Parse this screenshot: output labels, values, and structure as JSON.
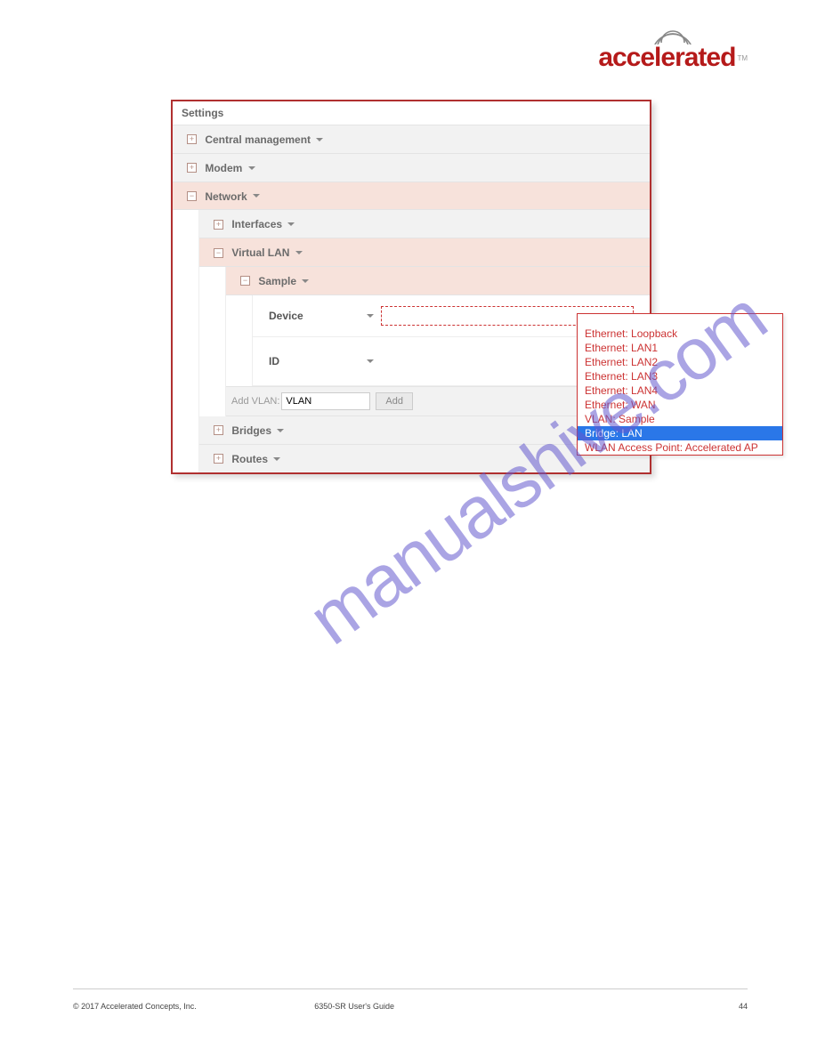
{
  "logo": {
    "text": "accelerated",
    "tm": "TM"
  },
  "panel": {
    "title": "Settings"
  },
  "rows": {
    "central": {
      "label": "Central management",
      "icon": "+"
    },
    "modem": {
      "label": "Modem",
      "icon": "+"
    },
    "network": {
      "label": "Network",
      "icon": "−"
    },
    "interfaces": {
      "label": "Interfaces",
      "icon": "+"
    },
    "vlan": {
      "label": "Virtual LAN",
      "icon": "−"
    },
    "sample": {
      "label": "Sample",
      "icon": "−"
    },
    "bridges": {
      "label": "Bridges",
      "icon": "+"
    },
    "routes": {
      "label": "Routes",
      "icon": "+"
    }
  },
  "fields": {
    "device": "Device",
    "id": "ID"
  },
  "add": {
    "label": "Add VLAN:",
    "value": "VLAN",
    "button": "Add"
  },
  "dropdown": {
    "options": [
      "Ethernet: Loopback",
      "Ethernet: LAN1",
      "Ethernet: LAN2",
      "Ethernet: LAN3",
      "Ethernet: LAN4",
      "Ethernet: WAN",
      "VLAN: Sample",
      "Bridge: LAN",
      "WLAN Access Point: Accelerated AP"
    ],
    "selected_index": 7
  },
  "watermark": "manualshive.com",
  "footer": {
    "copyright": "© 2017 Accelerated Concepts, Inc.",
    "model": "6350-SR User's Guide",
    "page": "44"
  }
}
